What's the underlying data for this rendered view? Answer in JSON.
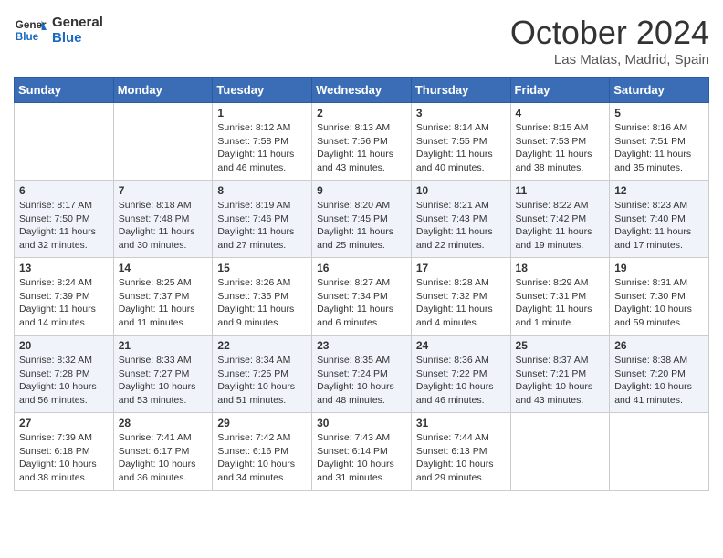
{
  "header": {
    "logo_general": "General",
    "logo_blue": "Blue",
    "month": "October 2024",
    "location": "Las Matas, Madrid, Spain"
  },
  "days_of_week": [
    "Sunday",
    "Monday",
    "Tuesday",
    "Wednesday",
    "Thursday",
    "Friday",
    "Saturday"
  ],
  "weeks": [
    [
      {
        "day": "",
        "info": ""
      },
      {
        "day": "",
        "info": ""
      },
      {
        "day": "1",
        "info": "Sunrise: 8:12 AM\nSunset: 7:58 PM\nDaylight: 11 hours and 46 minutes."
      },
      {
        "day": "2",
        "info": "Sunrise: 8:13 AM\nSunset: 7:56 PM\nDaylight: 11 hours and 43 minutes."
      },
      {
        "day": "3",
        "info": "Sunrise: 8:14 AM\nSunset: 7:55 PM\nDaylight: 11 hours and 40 minutes."
      },
      {
        "day": "4",
        "info": "Sunrise: 8:15 AM\nSunset: 7:53 PM\nDaylight: 11 hours and 38 minutes."
      },
      {
        "day": "5",
        "info": "Sunrise: 8:16 AM\nSunset: 7:51 PM\nDaylight: 11 hours and 35 minutes."
      }
    ],
    [
      {
        "day": "6",
        "info": "Sunrise: 8:17 AM\nSunset: 7:50 PM\nDaylight: 11 hours and 32 minutes."
      },
      {
        "day": "7",
        "info": "Sunrise: 8:18 AM\nSunset: 7:48 PM\nDaylight: 11 hours and 30 minutes."
      },
      {
        "day": "8",
        "info": "Sunrise: 8:19 AM\nSunset: 7:46 PM\nDaylight: 11 hours and 27 minutes."
      },
      {
        "day": "9",
        "info": "Sunrise: 8:20 AM\nSunset: 7:45 PM\nDaylight: 11 hours and 25 minutes."
      },
      {
        "day": "10",
        "info": "Sunrise: 8:21 AM\nSunset: 7:43 PM\nDaylight: 11 hours and 22 minutes."
      },
      {
        "day": "11",
        "info": "Sunrise: 8:22 AM\nSunset: 7:42 PM\nDaylight: 11 hours and 19 minutes."
      },
      {
        "day": "12",
        "info": "Sunrise: 8:23 AM\nSunset: 7:40 PM\nDaylight: 11 hours and 17 minutes."
      }
    ],
    [
      {
        "day": "13",
        "info": "Sunrise: 8:24 AM\nSunset: 7:39 PM\nDaylight: 11 hours and 14 minutes."
      },
      {
        "day": "14",
        "info": "Sunrise: 8:25 AM\nSunset: 7:37 PM\nDaylight: 11 hours and 11 minutes."
      },
      {
        "day": "15",
        "info": "Sunrise: 8:26 AM\nSunset: 7:35 PM\nDaylight: 11 hours and 9 minutes."
      },
      {
        "day": "16",
        "info": "Sunrise: 8:27 AM\nSunset: 7:34 PM\nDaylight: 11 hours and 6 minutes."
      },
      {
        "day": "17",
        "info": "Sunrise: 8:28 AM\nSunset: 7:32 PM\nDaylight: 11 hours and 4 minutes."
      },
      {
        "day": "18",
        "info": "Sunrise: 8:29 AM\nSunset: 7:31 PM\nDaylight: 11 hours and 1 minute."
      },
      {
        "day": "19",
        "info": "Sunrise: 8:31 AM\nSunset: 7:30 PM\nDaylight: 10 hours and 59 minutes."
      }
    ],
    [
      {
        "day": "20",
        "info": "Sunrise: 8:32 AM\nSunset: 7:28 PM\nDaylight: 10 hours and 56 minutes."
      },
      {
        "day": "21",
        "info": "Sunrise: 8:33 AM\nSunset: 7:27 PM\nDaylight: 10 hours and 53 minutes."
      },
      {
        "day": "22",
        "info": "Sunrise: 8:34 AM\nSunset: 7:25 PM\nDaylight: 10 hours and 51 minutes."
      },
      {
        "day": "23",
        "info": "Sunrise: 8:35 AM\nSunset: 7:24 PM\nDaylight: 10 hours and 48 minutes."
      },
      {
        "day": "24",
        "info": "Sunrise: 8:36 AM\nSunset: 7:22 PM\nDaylight: 10 hours and 46 minutes."
      },
      {
        "day": "25",
        "info": "Sunrise: 8:37 AM\nSunset: 7:21 PM\nDaylight: 10 hours and 43 minutes."
      },
      {
        "day": "26",
        "info": "Sunrise: 8:38 AM\nSunset: 7:20 PM\nDaylight: 10 hours and 41 minutes."
      }
    ],
    [
      {
        "day": "27",
        "info": "Sunrise: 7:39 AM\nSunset: 6:18 PM\nDaylight: 10 hours and 38 minutes."
      },
      {
        "day": "28",
        "info": "Sunrise: 7:41 AM\nSunset: 6:17 PM\nDaylight: 10 hours and 36 minutes."
      },
      {
        "day": "29",
        "info": "Sunrise: 7:42 AM\nSunset: 6:16 PM\nDaylight: 10 hours and 34 minutes."
      },
      {
        "day": "30",
        "info": "Sunrise: 7:43 AM\nSunset: 6:14 PM\nDaylight: 10 hours and 31 minutes."
      },
      {
        "day": "31",
        "info": "Sunrise: 7:44 AM\nSunset: 6:13 PM\nDaylight: 10 hours and 29 minutes."
      },
      {
        "day": "",
        "info": ""
      },
      {
        "day": "",
        "info": ""
      }
    ]
  ]
}
